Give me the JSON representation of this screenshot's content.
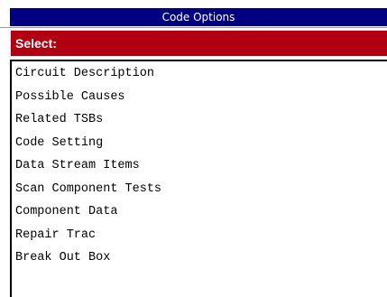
{
  "window": {
    "title": "Code Options"
  },
  "header": {
    "select_label": "Select:"
  },
  "menu": {
    "items": [
      "Circuit Description",
      "Possible Causes",
      "Related TSBs",
      "Code Setting",
      "Data Stream Items",
      "Scan Component Tests",
      "Component Data",
      "Repair Trac",
      "Break Out Box"
    ]
  },
  "colors": {
    "title_bar": "#000080",
    "select_bar": "#b00012",
    "background": "#ffffff"
  }
}
